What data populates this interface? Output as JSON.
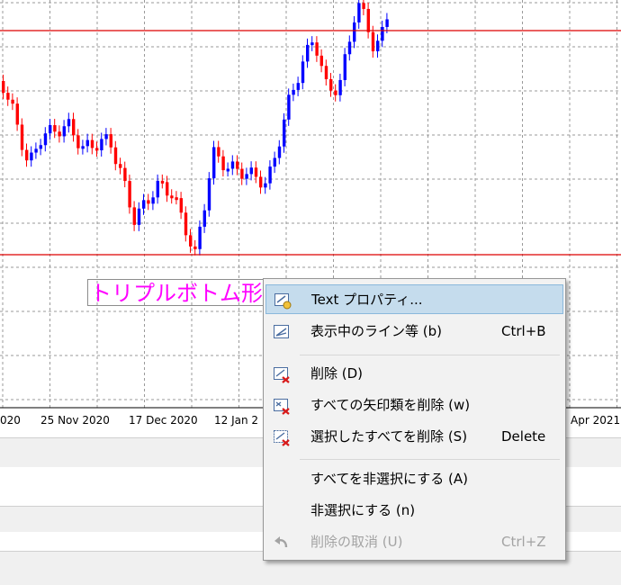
{
  "chart": {
    "time_labels": [
      "020",
      "25 Nov 2020",
      "17 Dec 2020",
      "12 Jan 2",
      "Apr 2021"
    ],
    "text_object": "トリプルボトム形",
    "text_color": "#ff00ff",
    "bull_color": "#0000ff",
    "bear_color": "#ff0000",
    "hline_color": "#dd0000"
  },
  "context_menu": {
    "items": [
      {
        "label": "Text プロパティ...",
        "shortcut": "",
        "icon": "text-properties-icon",
        "highlighted": true,
        "disabled": false
      },
      {
        "label": "表示中のライン等 (b)",
        "shortcut": "Ctrl+B",
        "icon": "object-list-icon",
        "highlighted": false,
        "disabled": false
      },
      {
        "label": "削除 (D)",
        "shortcut": "",
        "icon": "delete-object-icon",
        "highlighted": false,
        "disabled": false
      },
      {
        "label": "すべての矢印類を削除 (w)",
        "shortcut": "",
        "icon": "delete-arrows-icon",
        "highlighted": false,
        "disabled": false
      },
      {
        "label": "選択したすべてを削除 (S)",
        "shortcut": "Delete",
        "icon": "delete-selected-icon",
        "highlighted": false,
        "disabled": false
      },
      {
        "label": "すべてを非選択にする (A)",
        "shortcut": "",
        "icon": "",
        "highlighted": false,
        "disabled": false
      },
      {
        "label": "非選択にする (n)",
        "shortcut": "",
        "icon": "",
        "highlighted": false,
        "disabled": false
      },
      {
        "label": "削除の取消 (U)",
        "shortcut": "Ctrl+Z",
        "icon": "undo-icon",
        "highlighted": false,
        "disabled": true
      }
    ]
  }
}
